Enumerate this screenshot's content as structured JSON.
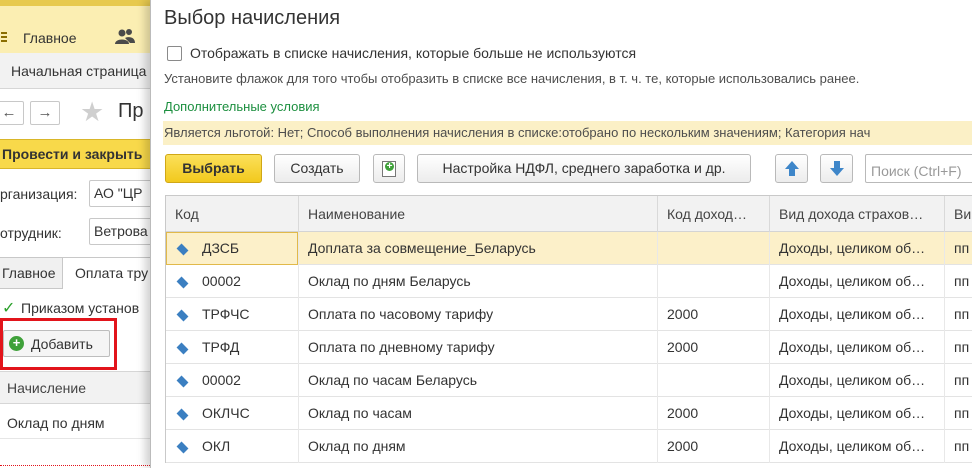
{
  "background": {
    "nav": {
      "home_label": "Главное"
    },
    "tabs": {
      "start_page": "Начальная страница"
    },
    "title_fragment": "Пр",
    "post_button": "Провести и закрыть",
    "fields": [
      {
        "label": "рганизация:",
        "value": "АО \"ЦР"
      },
      {
        "label": "отрудник:",
        "value": "Ветрова"
      }
    ],
    "subtabs": {
      "main": "Главное",
      "pay": "Оплата тру"
    },
    "approved_label": "Приказом установ",
    "add_button": "Добавить",
    "table": {
      "header": "Начисление",
      "row": "Оклад по дням"
    }
  },
  "dialog": {
    "title": "Выбор начисления",
    "show_unused_label": "Отображать в списке начисления, которые больше не используются",
    "hint": "Установите флажок для того чтобы отобразить в списке все начисления, в т. ч. те, которые использовались ранее.",
    "extra_conditions_link": "Дополнительные условия",
    "conditions_text": "Является льготой: Нет; Способ выполнения начисления в списке:отобрано по нескольким значениям; Категория нач",
    "toolbar": {
      "select": "Выбрать",
      "create": "Создать",
      "settings": "Настройка НДФЛ, среднего заработка и др.",
      "search_placeholder": "Поиск (Ctrl+F)"
    },
    "columns": [
      "Код",
      "Наименование",
      "Код доход…",
      "Вид дохода страхов…",
      "Ви"
    ],
    "rows": [
      {
        "code": "ДЗСБ",
        "name": "Доплата за совмещение_Беларусь",
        "income_code": "",
        "insurance": "Доходы, целиком об…",
        "extra": "пп"
      },
      {
        "code": "00002",
        "name": "Оклад по дням Беларусь",
        "income_code": "",
        "insurance": "Доходы, целиком об…",
        "extra": "пп"
      },
      {
        "code": "ТРФЧС",
        "name": "Оплата по часовому тарифу",
        "income_code": "2000",
        "insurance": "Доходы, целиком об…",
        "extra": "пп"
      },
      {
        "code": "ТРФД",
        "name": "Оплата по дневному тарифу",
        "income_code": "2000",
        "insurance": "Доходы, целиком об…",
        "extra": "пп"
      },
      {
        "code": "00002",
        "name": "Оклад по часам Беларусь",
        "income_code": "",
        "insurance": "Доходы, целиком об…",
        "extra": "пп"
      },
      {
        "code": "ОКЛЧС",
        "name": "Оклад по часам",
        "income_code": "2000",
        "insurance": "Доходы, целиком об…",
        "extra": "пп"
      },
      {
        "code": "ОКЛ",
        "name": "Оклад по дням",
        "income_code": "2000",
        "insurance": "Доходы, целиком об…",
        "extra": "пп"
      }
    ]
  },
  "colors": {
    "accent_yellow": "#f2c91d",
    "selected_row": "#fcf0c9",
    "link_green": "#1c8f3f",
    "highlight_red": "#e2141b"
  }
}
